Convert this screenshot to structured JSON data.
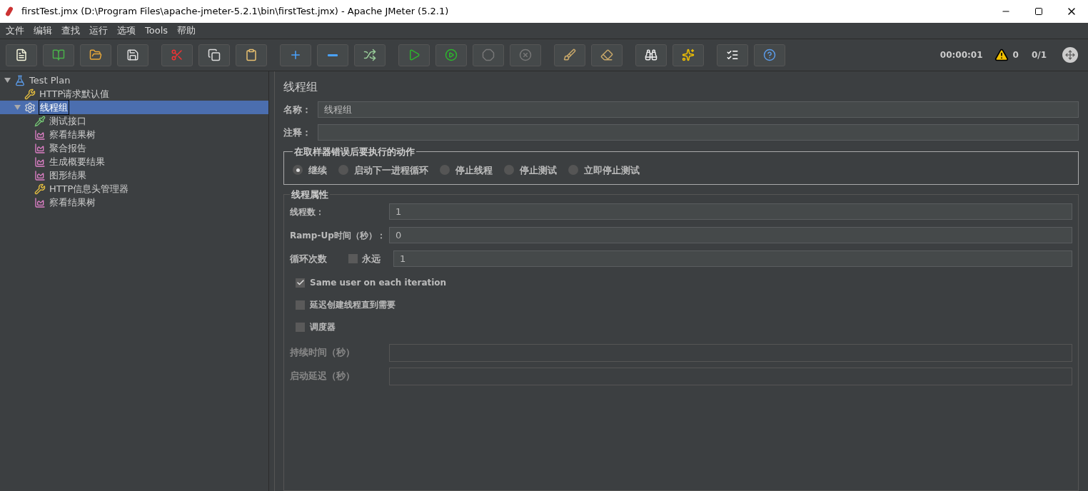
{
  "window": {
    "title": "firstTest.jmx (D:\\Program Files\\apache-jmeter-5.2.1\\bin\\firstTest.jmx) - Apache JMeter (5.2.1)"
  },
  "menu": [
    "文件",
    "编辑",
    "查找",
    "运行",
    "选项",
    "Tools",
    "帮助"
  ],
  "status": {
    "timer": "00:00:01",
    "warnings": "0",
    "threads": "0/1"
  },
  "tree": [
    {
      "label": "Test Plan",
      "kind": "plan",
      "selected": false,
      "expanded": true,
      "children": [
        {
          "label": "HTTP请求默认值",
          "kind": "config",
          "selected": false
        },
        {
          "label": "线程组",
          "kind": "threads",
          "selected": true,
          "expanded": true,
          "children": [
            {
              "label": "测试接口",
              "kind": "sampler",
              "selected": false
            },
            {
              "label": "察看结果树",
              "kind": "listener",
              "selected": false
            },
            {
              "label": "聚合报告",
              "kind": "listener",
              "selected": false
            },
            {
              "label": "生成概要结果",
              "kind": "listener",
              "selected": false
            },
            {
              "label": "图形结果",
              "kind": "listener",
              "selected": false
            },
            {
              "label": "HTTP信息头管理器",
              "kind": "config",
              "selected": false
            },
            {
              "label": "察看结果树",
              "kind": "listener",
              "selected": false
            }
          ]
        }
      ]
    }
  ],
  "panel": {
    "title": "线程组",
    "name": {
      "label": "名称：",
      "value": "线程组"
    },
    "comment": {
      "label": "注释："
    },
    "on_error": {
      "title": "在取样器错误后要执行的动作",
      "options": [
        {
          "label": "继续",
          "selected": true
        },
        {
          "label": "启动下一进程循环",
          "selected": false
        },
        {
          "label": "停止线程",
          "selected": false
        },
        {
          "label": "停止测试",
          "selected": false
        },
        {
          "label": "立即停止测试",
          "selected": false
        }
      ]
    },
    "properties": {
      "title": "线程属性",
      "threads": {
        "label": "线程数：",
        "value": "1"
      },
      "rampup": {
        "label": "Ramp-Up时间（秒）：",
        "value": "0"
      },
      "loops": {
        "label": "循环次数",
        "forever_label": "永远",
        "forever": false,
        "value": "1"
      },
      "checks": [
        {
          "label": "Same user on each iteration",
          "checked": true
        },
        {
          "label": "延迟创建线程直到需要",
          "checked": false
        },
        {
          "label": "调度器",
          "checked": false
        }
      ],
      "timing": [
        {
          "label": "持续时间（秒）",
          "disabled": true
        },
        {
          "label": "启动延迟（秒）",
          "disabled": true
        }
      ]
    }
  }
}
